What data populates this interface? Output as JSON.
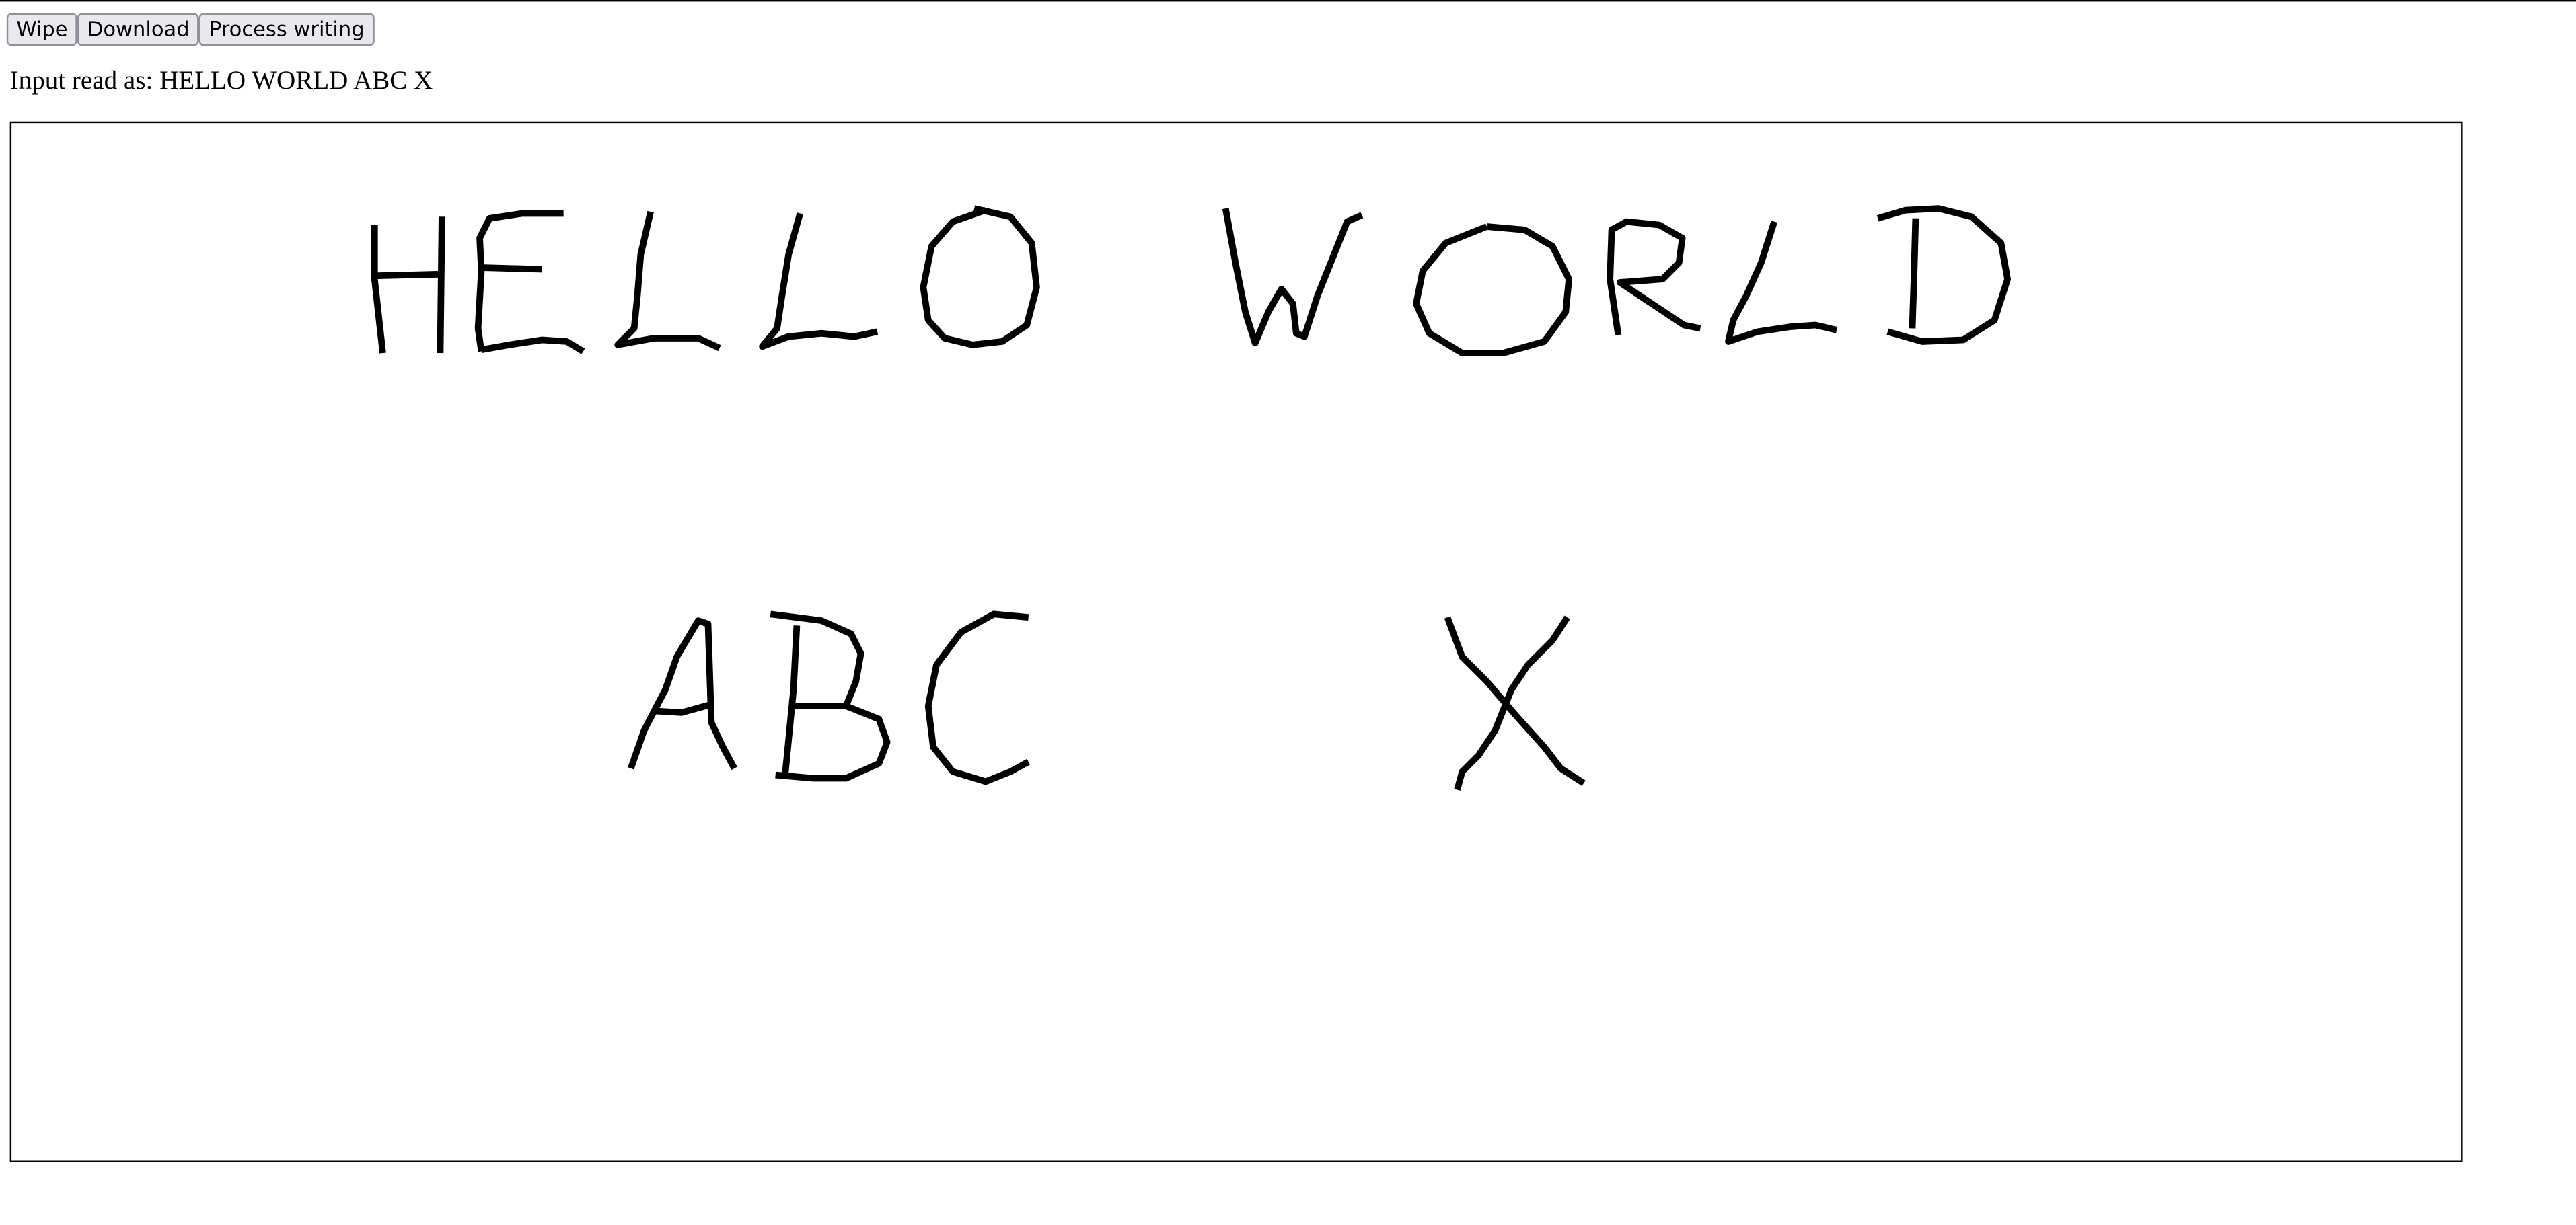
{
  "toolbar": {
    "wipe_label": "Wipe",
    "download_label": "Download",
    "process_label": "Process writing"
  },
  "status": {
    "prefix": "Input read as:",
    "recognized_text": "HELLO WORLD ABC X"
  },
  "canvas": {
    "ink_color": "#000000",
    "background_color": "#ffffff"
  }
}
